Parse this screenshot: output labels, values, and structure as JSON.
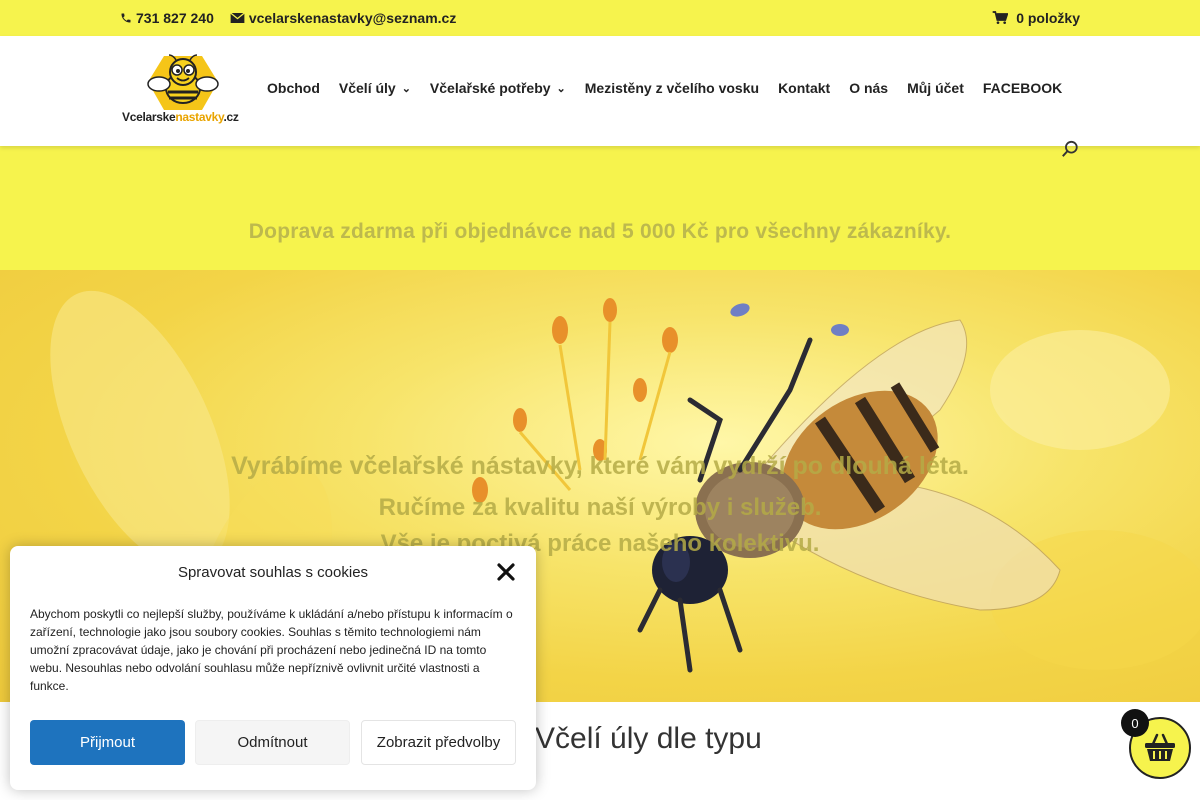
{
  "topbar": {
    "phone": "731 827 240",
    "email": "vcelarskenastavky@seznam.cz",
    "cart_label": "0 položky"
  },
  "header": {
    "logo_text_a": "Vcelarske",
    "logo_text_b": "nastavky",
    "logo_text_c": ".cz",
    "nav": [
      {
        "label": "Obchod",
        "dropdown": false
      },
      {
        "label": "Včelí úly",
        "dropdown": true
      },
      {
        "label": "Včelařské potřeby",
        "dropdown": true
      },
      {
        "label": "Mezistěny z včelího vosku",
        "dropdown": false
      },
      {
        "label": "Kontakt",
        "dropdown": false
      },
      {
        "label": "O nás",
        "dropdown": false
      },
      {
        "label": "Můj účet",
        "dropdown": false
      },
      {
        "label": "FACEBOOK",
        "dropdown": false
      }
    ]
  },
  "shipping_text": "Doprava zdarma při objednávce nad 5 000 Kč pro všechny zákazníky.",
  "hero": {
    "line1": "Vyrábíme včelařské nástavky, které vám vydrží po dlouhá léta.",
    "line2": "Ručíme za kvalitu naší výroby i služeb.",
    "line3": "Vše je poctivá práce našeho kolektivu."
  },
  "section_title": "Včelí úly dle typu",
  "cookie": {
    "title": "Spravovat souhlas s cookies",
    "body": "Abychom poskytli co nejlepší služby, používáme k ukládání a/nebo přístupu k informacím o zařízení, technologie jako jsou soubory cookies. Souhlas s těmito technologiemi nám umožní zpracovávat údaje, jako je chování při procházení nebo jedinečná ID na tomto webu. Nesouhlas nebo odvolání souhlasu může nepříznivě ovlivnit určité vlastnosti a funkce.",
    "accept": "Přijmout",
    "deny": "Odmítnout",
    "prefs": "Zobrazit předvolby"
  },
  "cart_count": "0",
  "colors": {
    "brand_yellow": "#f6f34d",
    "accept_blue": "#1e73be"
  }
}
